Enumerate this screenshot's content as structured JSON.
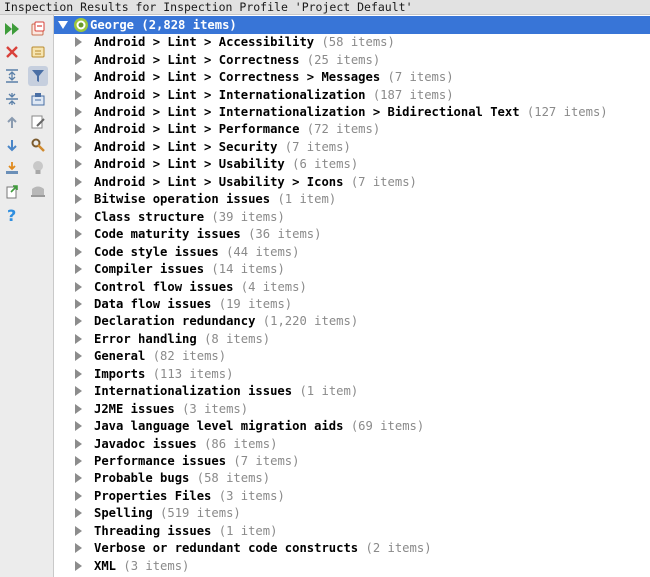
{
  "window": {
    "title": "Inspection Results for Inspection Profile 'Project Default'"
  },
  "toolbar": {
    "icons": [
      "rerun-icon",
      "close-icon",
      "expand-all-icon",
      "collapse-all-icon",
      "previous-icon",
      "next-icon",
      "export-icon",
      "export-file-icon",
      "help-icon",
      "group-icon",
      "group-by-file-icon",
      "filter-icon",
      "module-icon",
      "edit-icon",
      "settings-icon",
      "lightbulb-icon",
      "suppress-icon"
    ],
    "colors": {
      "run": "#3e9c3a",
      "close": "#d9413a",
      "nav": "#4a86c8",
      "help": "#2f8fe0",
      "selection": "#3875d7"
    }
  },
  "tree": {
    "root": {
      "label": "George",
      "count": "(2,828 items)"
    },
    "items": [
      {
        "label": "Android > Lint > Accessibility",
        "count": "(58 items)"
      },
      {
        "label": "Android > Lint > Correctness",
        "count": "(25 items)"
      },
      {
        "label": "Android > Lint > Correctness > Messages",
        "count": "(7 items)"
      },
      {
        "label": "Android > Lint > Internationalization",
        "count": "(187 items)"
      },
      {
        "label": "Android > Lint > Internationalization > Bidirectional Text",
        "count": "(127 items)"
      },
      {
        "label": "Android > Lint > Performance",
        "count": "(72 items)"
      },
      {
        "label": "Android > Lint > Security",
        "count": "(7 items)"
      },
      {
        "label": "Android > Lint > Usability",
        "count": "(6 items)"
      },
      {
        "label": "Android > Lint > Usability > Icons",
        "count": "(7 items)"
      },
      {
        "label": "Bitwise operation issues",
        "count": "(1 item)"
      },
      {
        "label": "Class structure",
        "count": "(39 items)"
      },
      {
        "label": "Code maturity issues",
        "count": "(36 items)"
      },
      {
        "label": "Code style issues",
        "count": "(44 items)"
      },
      {
        "label": "Compiler issues",
        "count": "(14 items)"
      },
      {
        "label": "Control flow issues",
        "count": "(4 items)"
      },
      {
        "label": "Data flow issues",
        "count": "(19 items)"
      },
      {
        "label": "Declaration redundancy",
        "count": "(1,220 items)"
      },
      {
        "label": "Error handling",
        "count": "(8 items)"
      },
      {
        "label": "General",
        "count": "(82 items)"
      },
      {
        "label": "Imports",
        "count": "(113 items)"
      },
      {
        "label": "Internationalization issues",
        "count": "(1 item)"
      },
      {
        "label": "J2ME issues",
        "count": "(3 items)"
      },
      {
        "label": "Java language level migration aids",
        "count": "(69 items)"
      },
      {
        "label": "Javadoc issues",
        "count": "(86 items)"
      },
      {
        "label": "Performance issues",
        "count": "(7 items)"
      },
      {
        "label": "Probable bugs",
        "count": "(58 items)"
      },
      {
        "label": "Properties Files",
        "count": "(3 items)"
      },
      {
        "label": "Spelling",
        "count": "(519 items)"
      },
      {
        "label": "Threading issues",
        "count": "(1 item)"
      },
      {
        "label": "Verbose or redundant code constructs",
        "count": "(2 items)"
      },
      {
        "label": "XML",
        "count": "(3 items)"
      }
    ]
  }
}
